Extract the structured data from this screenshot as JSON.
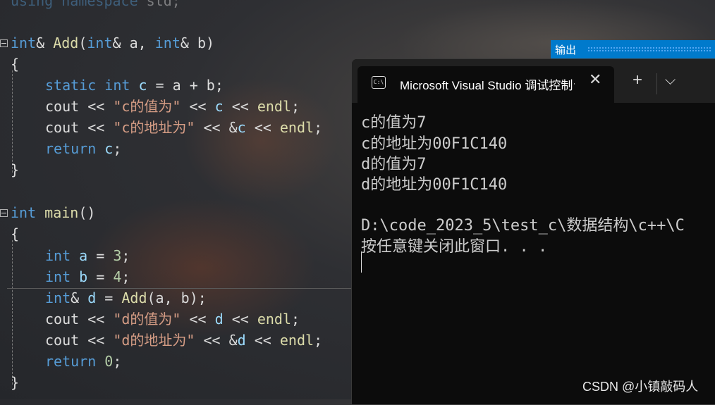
{
  "editor": {
    "lines": {
      "l0": {
        "a": "using",
        "b": " namespace ",
        "c": "std;"
      },
      "l1": {
        "kw1": "int",
        "t1": "& ",
        "fn": "Add",
        "t2": "(",
        "kw2": "int",
        "t3": "& a, ",
        "kw3": "int",
        "t4": "& b)"
      },
      "l2": "{",
      "l3": {
        "kw1": "static",
        "sp": " ",
        "kw2": "int",
        "v": " c",
        "rest": " = a + b;"
      },
      "l4": {
        "t1": "cout << ",
        "s": "\"c的值为\"",
        "t2": " << ",
        "v": "c",
        "t3": " << ",
        "e": "endl",
        "t4": ";"
      },
      "l5": {
        "t1": "cout << ",
        "s": "\"c的地址为\"",
        "t2": " << &",
        "v": "c",
        "t3": " << ",
        "e": "endl",
        "t4": ";"
      },
      "l6": {
        "kw": "return",
        "v": " c",
        "t": ";"
      },
      "l7": "}",
      "l8": {
        "kw": "int",
        "fn": " main",
        "t": "()"
      },
      "l9": "{",
      "l10": {
        "kw": "int",
        "v": " a",
        "t1": " = ",
        "n": "3",
        "t2": ";"
      },
      "l11": {
        "kw": "int",
        "v": " b",
        "t1": " = ",
        "n": "4",
        "t2": ";"
      },
      "l12": {
        "kw": "int",
        "t1": "& ",
        "v": "d",
        "t2": " = ",
        "fn": "Add",
        "t3": "(a, b);"
      },
      "l13": {
        "t1": "cout << ",
        "s": "\"d的值为\"",
        "t2": " << ",
        "v": "d",
        "t3": " << ",
        "e": "endl",
        "t4": ";"
      },
      "l14": {
        "t1": "cout << ",
        "s": "\"d的地址为\"",
        "t2": " << &",
        "v": "d",
        "t3": " << ",
        "e": "endl",
        "t4": ";"
      },
      "l15": {
        "kw": "return",
        "t1": " ",
        "n": "0",
        "t2": ";"
      },
      "l16": "}"
    }
  },
  "output_panel": {
    "label": "输出"
  },
  "terminal": {
    "tab_title": "Microsoft Visual Studio 调试控制台",
    "icon_label": "C:\\",
    "close_glyph": "✕",
    "plus_glyph": "+",
    "chevron_glyph": "⌵",
    "lines": [
      "c的值为7",
      "c的地址为00F1C140",
      "d的值为7",
      "d的地址为00F1C140",
      "",
      "D:\\code_2023_5\\test_c\\数据结构\\c++\\C",
      "按任意键关闭此窗口. . ."
    ]
  },
  "watermark": "CSDN @小镇敲码人",
  "colors": {
    "keyword": "#569cd6",
    "function": "#dcdcaa",
    "variable": "#9cdcfe",
    "string": "#d69d85",
    "number": "#b5cea8",
    "accent": "#007acc"
  }
}
